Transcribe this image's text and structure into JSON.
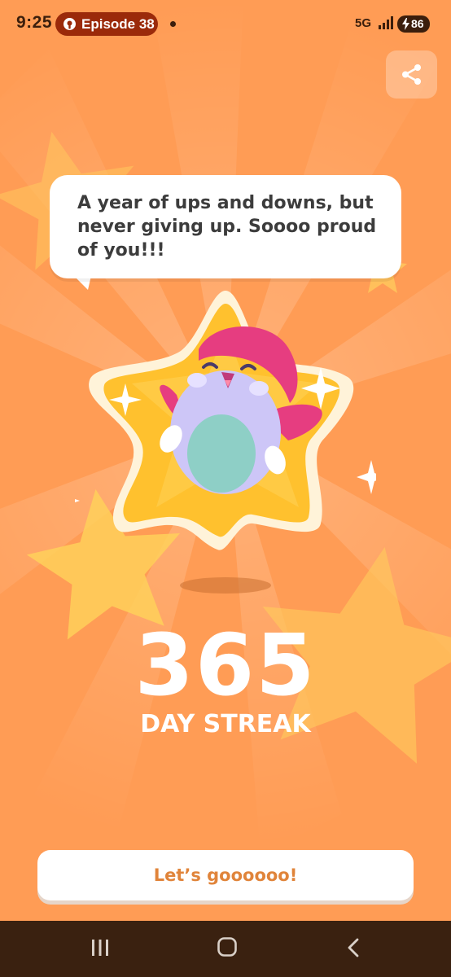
{
  "status_bar": {
    "time": "9:25",
    "notification_pill": "Episode 38",
    "network": "5G",
    "battery": "86"
  },
  "speech_bubble": {
    "text": "A year of ups and downs, but never giving up. Soooo proud of you!!!"
  },
  "streak": {
    "number": "365",
    "label": "DAY STREAK"
  },
  "cta": {
    "label": "Let’s goooooo!"
  },
  "icons": {
    "share": "share-icon",
    "recents": "recents-icon",
    "home": "home-icon",
    "back": "back-icon"
  },
  "colors": {
    "background": "#ff9c55",
    "cta_text": "#e0843a",
    "star": "#ffc12e",
    "mascot_body": "#cdc6f7",
    "mascot_hat": "#e63d80",
    "nav_bar": "#3a2110"
  }
}
